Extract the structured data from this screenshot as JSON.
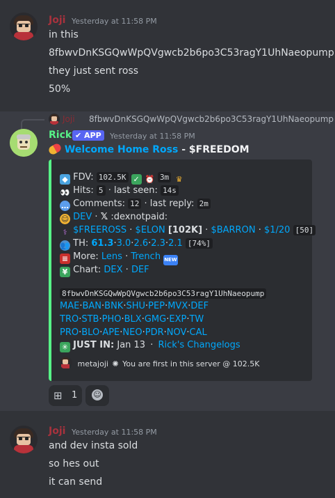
{
  "msg1": {
    "username": "Joji",
    "timestamp": "Yesterday at 11:58 PM",
    "lines": [
      "in this",
      "8fbwvDnKSGQwWpQVgwcb2b6po3C53ragY1UhNaeopump",
      "they just sent ross",
      "50%"
    ]
  },
  "reply": {
    "username": "Joji",
    "text": "8fbwvDnKSGQwWpQVgwcb2b6po3C53ragY1UhNaeopump"
  },
  "rick": {
    "username": "Rick",
    "badge": "APP",
    "timestamp": "Yesterday at 11:58 PM",
    "title_link": "Welcome Home Ross",
    "title_sep": " - ",
    "title_ticker": "$FREEDOM",
    "embed": {
      "fdv_label": "FDV:",
      "fdv_value": "102.5K",
      "age": "3m",
      "hits_label": "Hits:",
      "hits_value": "5",
      "last_seen_label": "· last seen:",
      "last_seen_value": "14s",
      "comments_label": "Comments:",
      "comments_value": "12",
      "last_reply_label": "· last reply:",
      "last_reply_value": "2m",
      "dev_label": "DEV",
      "dev_sep": "·",
      "dev_x": "𝕏",
      "dev_emote": ":dexnotpaid:",
      "tokens": [
        "$FREEROSS",
        "$ELON",
        "$BARRON",
        "$1/20"
      ],
      "elon_bracket": "[102K]",
      "token_count": "[50]",
      "th_label": "TH:",
      "th_main": "61.3",
      "th_rest": [
        "3.0",
        "2.6",
        "2.3",
        "2.1"
      ],
      "th_pct": "[74%]",
      "more_label": "More:",
      "more_links": [
        "Lens",
        "Trench"
      ],
      "new_badge": "NEW",
      "chart_label": "Chart:",
      "chart_links": [
        "DEX",
        "DEF"
      ],
      "contract": "8fbwvDnKSGQwWpQVgwcb2b6po3C53ragY1UhNaeopump",
      "link_row1": [
        "MAE",
        "BAN",
        "BNK",
        "SHU",
        "PEP",
        "MVX",
        "DEF"
      ],
      "link_row2": [
        "TRO",
        "STB",
        "PHO",
        "BLX",
        "GMG",
        "EXP",
        "TW"
      ],
      "link_row3": [
        "PRO",
        "BLO",
        "APE",
        "NEO",
        "PDR",
        "NOV",
        "CAL"
      ],
      "justin_label": "JUST IN:",
      "justin_date": "Jan 13",
      "justin_sep": "·",
      "justin_link": "Rick's Changelogs",
      "footer_user": "metajoji",
      "footer_text": "You are first in this server @ 102.5K"
    },
    "reaction_count": "1"
  },
  "msg3": {
    "username": "Joji",
    "timestamp": "Yesterday at 11:58 PM",
    "lines": [
      "and dev insta sold",
      "so hes out",
      "it can send"
    ]
  },
  "colors": {
    "background": "#313338",
    "joji_name": "#a8323d",
    "rick_name": "#57f287",
    "link": "#00a8fc",
    "embed_border": "#57f287"
  }
}
